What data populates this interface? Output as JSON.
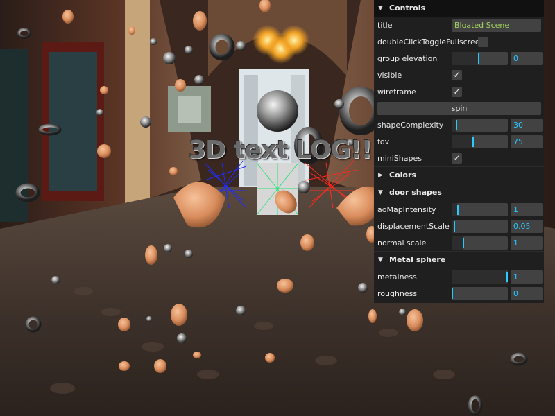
{
  "scene": {
    "text3d": "3D text LOG!!"
  },
  "gui": {
    "controls_title": "Controls",
    "title_label": "title",
    "title_value": "Bloated Scene",
    "dblclick_label": "doubleClickToggleFullscreen",
    "dblclick_checked": false,
    "group_elevation_label": "group elevation",
    "group_elevation_value": "0",
    "group_elevation_fraction": 0.48,
    "visible_label": "visible",
    "visible_checked": true,
    "wireframe_label": "wireframe",
    "wireframe_checked": true,
    "spin_label": "spin",
    "shape_complexity_label": "shapeComplexity",
    "shape_complexity_value": "30",
    "shape_complexity_fraction": 0.08,
    "fov_label": "fov",
    "fov_value": "75",
    "fov_fraction": 0.38,
    "mini_shapes_label": "miniShapes",
    "mini_shapes_checked": true,
    "colors_title": "Colors",
    "door_shapes_title": "door shapes",
    "ao_label": "aoMapIntensity",
    "ao_value": "1",
    "ao_fraction": 0.1,
    "displacement_label": "displacementScale",
    "displacement_value": "0.05",
    "displacement_fraction": 0.04,
    "normal_label": "normal scale",
    "normal_value": "1",
    "normal_fraction": 0.2,
    "metal_title": "Metal sphere",
    "metalness_label": "metalness",
    "metalness_value": "1",
    "metalness_fraction": 1.0,
    "roughness_label": "roughness",
    "roughness_value": "0",
    "roughness_fraction": 0.0,
    "accent_color": "#2cc9ff",
    "string_color": "#a4d65e"
  }
}
